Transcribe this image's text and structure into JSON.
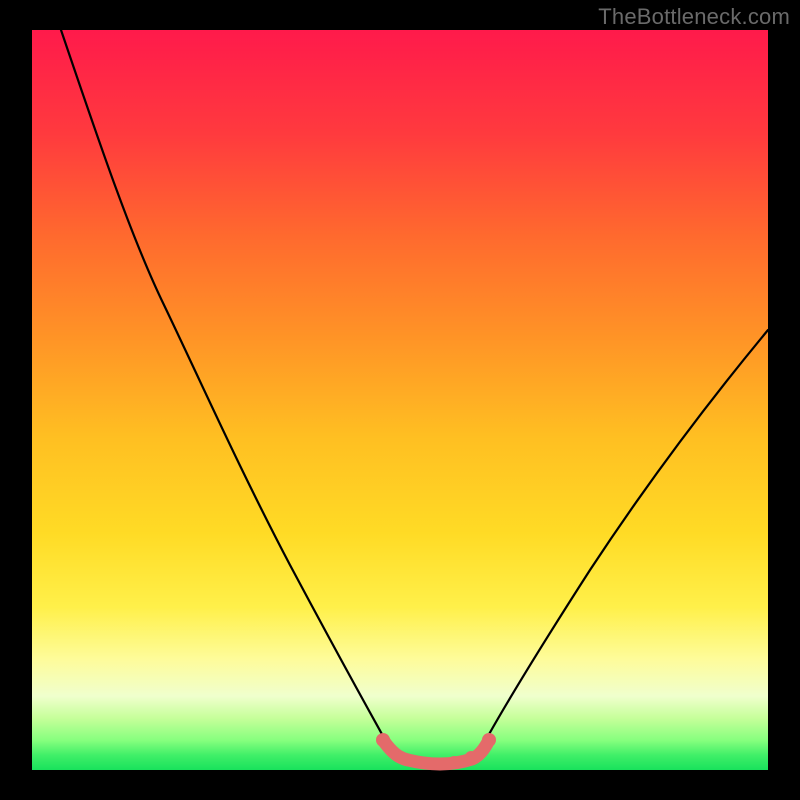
{
  "watermark": {
    "text": "TheBottleneck.com"
  },
  "chart_data": {
    "type": "line",
    "title": "",
    "xlabel": "",
    "ylabel": "",
    "xlim": [
      0,
      100
    ],
    "ylim": [
      0,
      100
    ],
    "grid": false,
    "legend": null,
    "background": {
      "type": "vertical-gradient",
      "stops": [
        {
          "offset": 0.0,
          "color": "#ff1a4b"
        },
        {
          "offset": 0.25,
          "color": "#ff6a2e"
        },
        {
          "offset": 0.5,
          "color": "#ffb61f"
        },
        {
          "offset": 0.7,
          "color": "#ffe22a"
        },
        {
          "offset": 0.83,
          "color": "#fff65a"
        },
        {
          "offset": 0.9,
          "color": "#fcffb0"
        },
        {
          "offset": 0.94,
          "color": "#d6ff8c"
        },
        {
          "offset": 0.97,
          "color": "#7cff7a"
        },
        {
          "offset": 1.0,
          "color": "#18e25c"
        }
      ]
    },
    "series": [
      {
        "name": "bottleneck-curve",
        "type": "curve",
        "stroke": "#000000",
        "points": [
          {
            "x": 4,
            "y": 100
          },
          {
            "x": 10,
            "y": 83
          },
          {
            "x": 18,
            "y": 64
          },
          {
            "x": 26,
            "y": 46
          },
          {
            "x": 34,
            "y": 28
          },
          {
            "x": 42,
            "y": 12
          },
          {
            "x": 47,
            "y": 3.5
          },
          {
            "x": 49,
            "y": 1.6
          },
          {
            "x": 54,
            "y": 0.9
          },
          {
            "x": 59,
            "y": 1.6
          },
          {
            "x": 61,
            "y": 3.5
          },
          {
            "x": 68,
            "y": 12
          },
          {
            "x": 78,
            "y": 26
          },
          {
            "x": 90,
            "y": 42
          },
          {
            "x": 100,
            "y": 55
          }
        ]
      },
      {
        "name": "optimal-zone-highlight",
        "type": "curve",
        "stroke": "#e46a6a",
        "points": [
          {
            "x": 47,
            "y": 3.5
          },
          {
            "x": 49,
            "y": 1.6
          },
          {
            "x": 54,
            "y": 0.9
          },
          {
            "x": 59,
            "y": 1.6
          },
          {
            "x": 61,
            "y": 3.5
          }
        ]
      }
    ]
  }
}
